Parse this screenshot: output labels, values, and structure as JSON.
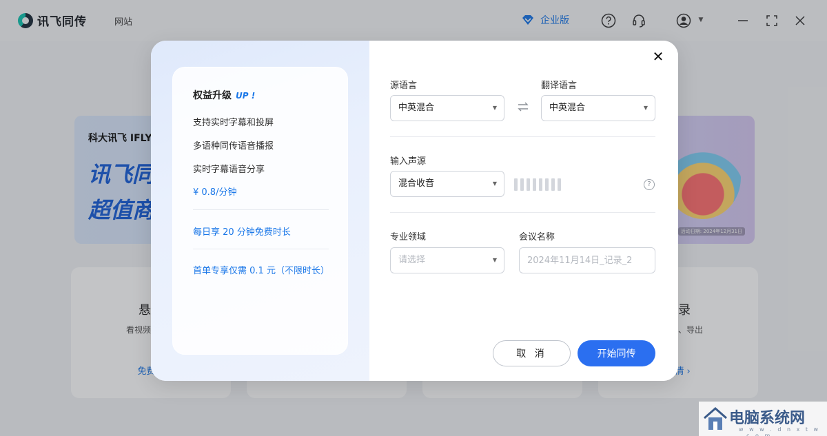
{
  "titlebar": {
    "app_name": "讯飞同传",
    "nav_site": "网站",
    "enterprise_label": "企业版",
    "icons": [
      "help-icon",
      "headset-support-icon",
      "user-avatar-icon",
      "chevron-down-icon",
      "minimize-icon",
      "maximize-icon",
      "close-icon"
    ]
  },
  "background": {
    "banner": {
      "logo_text": "科大讯飞 IFLYTEK",
      "headline_1": "讯飞同",
      "headline_2": "超值商",
      "date_text": "活动日期: 2024年12月31日"
    },
    "cards": [
      {
        "title": "悬浮",
        "desc": "看视频直播，",
        "link": "免费体"
      },
      {
        "title": "",
        "desc": "",
        "link": ""
      },
      {
        "title": "",
        "desc": "",
        "link": ""
      },
      {
        "title": "记录",
        "desc": "、编辑、导出",
        "link": "详情 ›"
      }
    ]
  },
  "modal": {
    "promo": {
      "title": "权益升级",
      "up_tag": "UP !",
      "features": [
        "支持实时字幕和投屏",
        "多语种同传语音播报",
        "实时字幕语音分享"
      ],
      "price": "¥ 0.8/分钟",
      "offer_daily": "每日享 20 分钟免费时长",
      "offer_first": "首单专享仅需 0.1 元（不限时长）"
    },
    "form": {
      "source_lang_label": "源语言",
      "source_lang_value": "中英混合",
      "target_lang_label": "翻译语言",
      "target_lang_value": "中英混合",
      "input_source_label": "输入声源",
      "input_source_value": "混合收音",
      "domain_label": "专业领域",
      "domain_placeholder": "请选择",
      "meeting_name_label": "会议名称",
      "meeting_name_placeholder": "2024年11月14日_记录_2"
    },
    "buttons": {
      "cancel": "取 消",
      "start": "开始同传"
    },
    "close_symbol": "✕"
  },
  "watermark": {
    "text": "电脑系统网",
    "url": "w w w . d n x t w . c o m"
  },
  "colors": {
    "accent": "#2b6ff0",
    "link": "#1a77e8",
    "overlay": "rgba(40,44,52,0.28)"
  }
}
